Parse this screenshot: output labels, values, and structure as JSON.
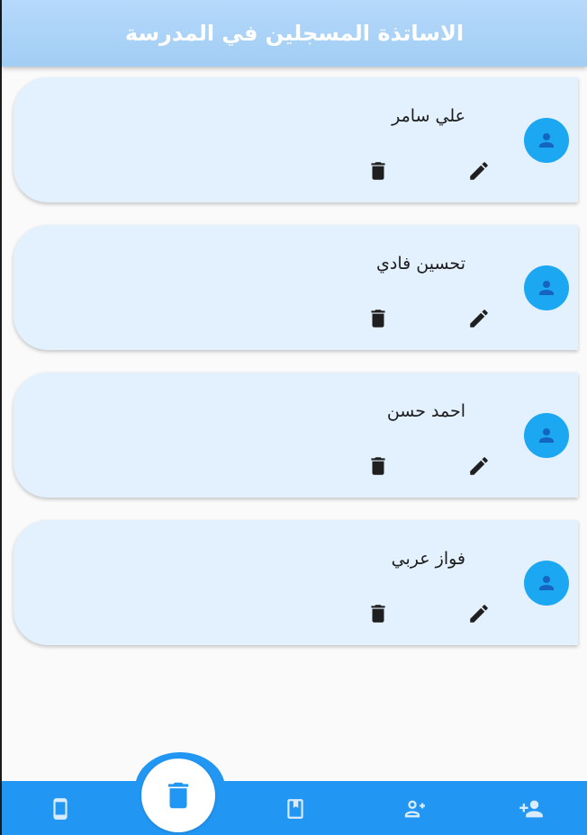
{
  "app_bar": {
    "title": "الاساتذة المسجلين في المدرسة"
  },
  "teachers": [
    {
      "name": "علي سامر"
    },
    {
      "name": "تحسين فادي"
    },
    {
      "name": "احمد حسن"
    },
    {
      "name": "فواز عربي"
    }
  ],
  "card_actions": {
    "edit_icon": "pencil-icon",
    "delete_icon": "trash-icon",
    "avatar_icon": "person-icon"
  },
  "bottom_nav": {
    "fab_icon": "trash-icon",
    "items": [
      {
        "icon": "phone-icon"
      },
      {
        "icon": "book-icon"
      },
      {
        "icon": "person-add-outline-icon"
      },
      {
        "icon": "person-add-icon"
      }
    ]
  },
  "colors": {
    "header_bg": "#a9d2f7",
    "card_bg": "#e3f0fd",
    "avatar_bg": "#1ca7f2",
    "nav_bg": "#2196f3",
    "icon_dark": "#1f1f1f"
  }
}
